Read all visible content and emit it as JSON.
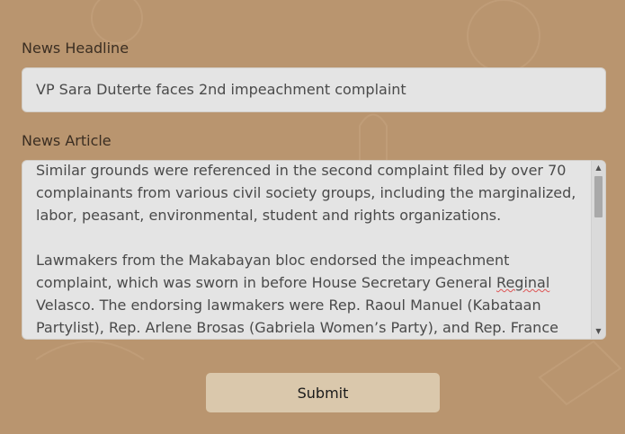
{
  "form": {
    "headline_label": "News Headline",
    "headline_value": "VP Sara Duterte faces 2nd impeachment complaint",
    "article_label": "News Article",
    "article_paragraphs": [
      {
        "before": "Similar grounds were referenced in the second complaint filed by over 70 complainants from various civil society groups, including the marginalized, labor, peasant, environmental, student and rights organizations.",
        "flagged": "",
        "after": ""
      },
      {
        "before": "Lawmakers from the Makabayan bloc endorsed the impeachment complaint, which was sworn in before House Secretary General ",
        "flagged": "Reginal",
        "after": " Velasco. The endorsing lawmakers were Rep. Raoul Manuel (Kabataan Partylist), Rep. Arlene Brosas (Gabriela Women’s Party), and Rep. France"
      }
    ],
    "submit_label": "Submit"
  },
  "colors": {
    "background": "#b9956f",
    "field_background": "#e4e4e4",
    "button_background": "#dac8ac"
  },
  "icons": {
    "scroll_up": "triangle-up-icon",
    "scroll_down": "triangle-down-icon"
  }
}
